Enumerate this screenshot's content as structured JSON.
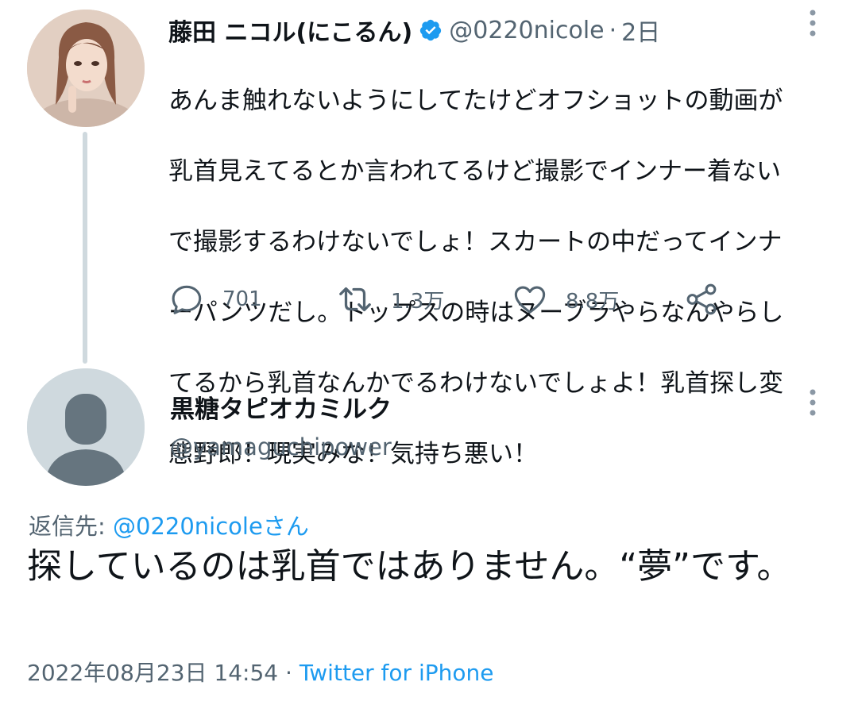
{
  "tweet1": {
    "name": "藤田 ニコル(にこるん)",
    "handle": "@0220nicole",
    "separator": "·",
    "time": "2日",
    "lines": [
      "あんま触れないようにしてたけどオフショットの動画が",
      "乳首見えてるとか言われてるけど撮影でインナー着ない",
      "で撮影するわけないでしょ！スカートの中だってインナ",
      "ーパンツだし。トップスの時はヌーブラやらなんやらし",
      "てるから乳首なんかでるわけないでしょよ！乳首探し変",
      "態野郎！現実みな！気持ち悪い！"
    ],
    "actions": {
      "reply_icon": "reply-icon",
      "reply_count": "701",
      "retweet_icon": "retweet-icon",
      "retweet_count": "1.3万",
      "like_icon": "heart-icon",
      "like_count": "8.8万",
      "share_icon": "share-icon"
    }
  },
  "tweet2": {
    "name": "黒糖タピオカミルク",
    "handle": "@yamaguchipower",
    "reply_label": "返信先: ",
    "reply_mention": "@0220nicoleさん",
    "text": "探しているのは乳首ではありません。“夢”です。",
    "timestamp": "2022年08月23日 14:54",
    "meta_separator": " · ",
    "source": "Twitter for iPhone"
  },
  "colors": {
    "accent": "#1d9bf0",
    "secondary_text": "#536471",
    "thread_line": "#cfd9de"
  }
}
